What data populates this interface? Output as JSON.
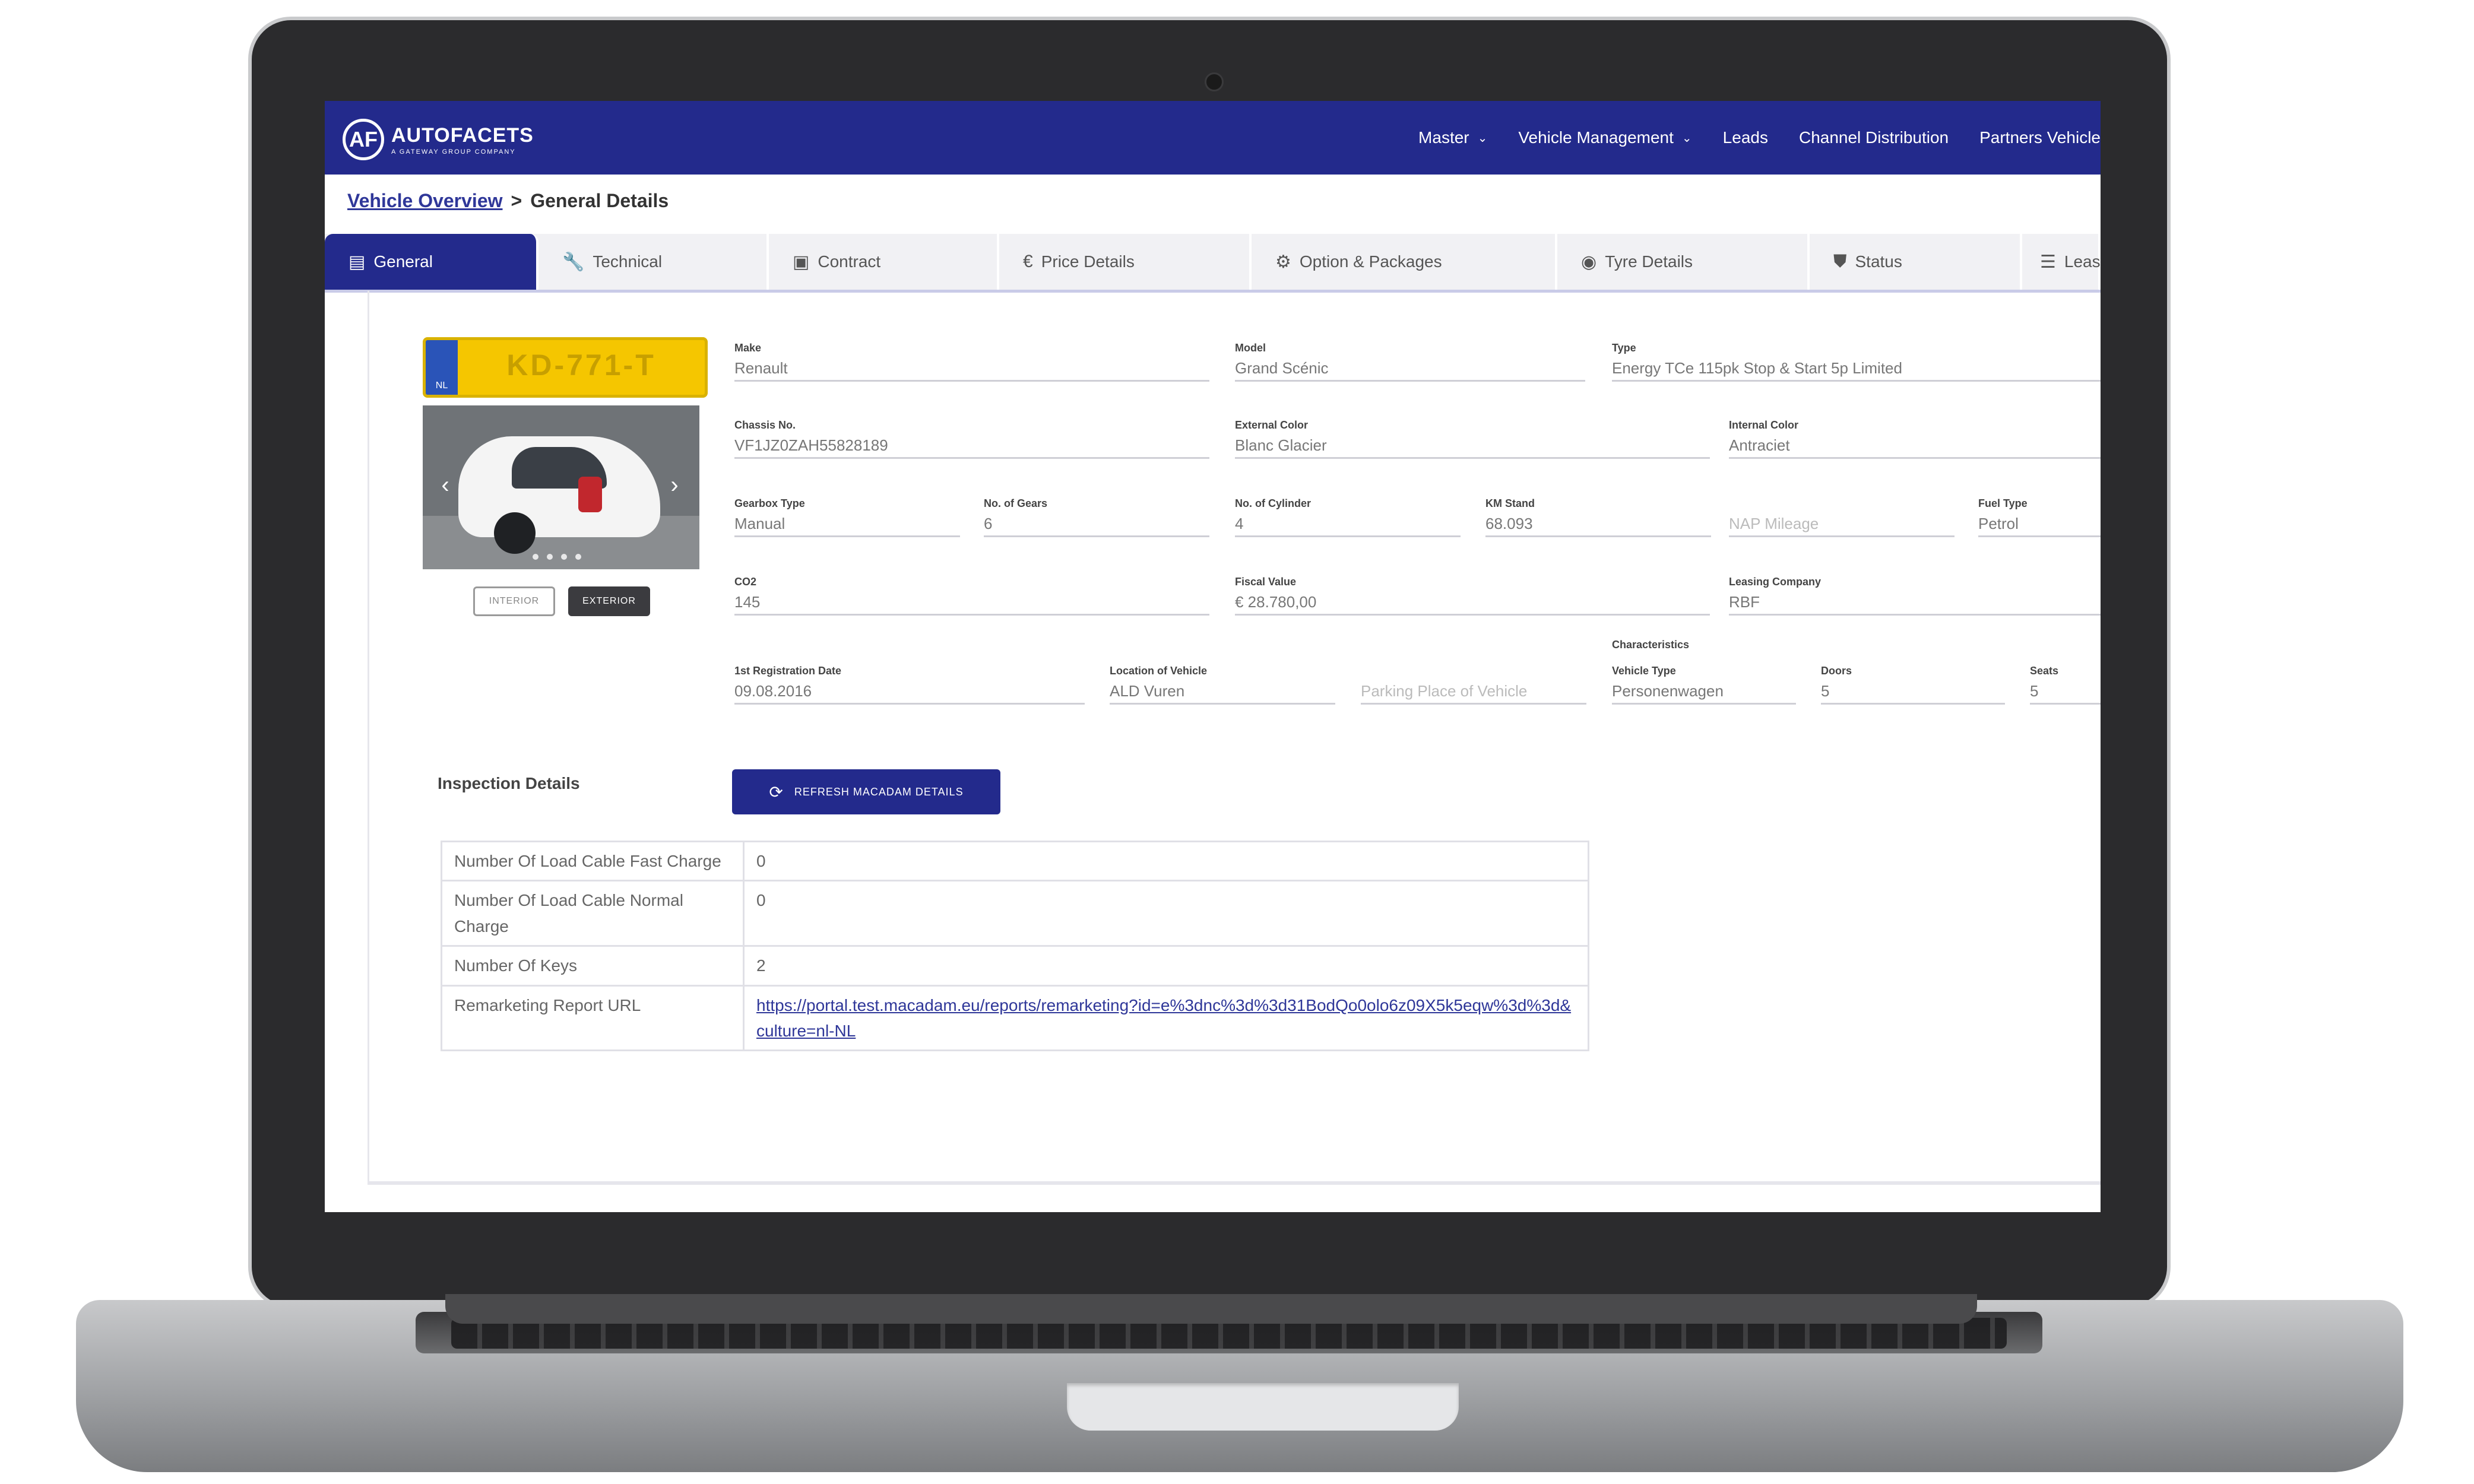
{
  "app": {
    "logo_mark": "AF",
    "logo_name": "AUTOFACETS",
    "logo_tagline": "A GATEWAY GROUP COMPANY"
  },
  "nav": {
    "items": [
      "Master",
      "Vehicle Management",
      "Leads",
      "Channel Distribution",
      "Partners Vehicle"
    ],
    "caret": "⌄"
  },
  "breadcrumb": {
    "link": "Vehicle Overview",
    "separator": ">",
    "current": "General Details"
  },
  "tabs": [
    {
      "label": "General",
      "icon": "file-icon",
      "glyph": "▤"
    },
    {
      "label": "Technical",
      "icon": "wrench-icon",
      "glyph": "🔧"
    },
    {
      "label": "Contract",
      "icon": "contract-icon",
      "glyph": "▣"
    },
    {
      "label": "Price Details",
      "icon": "euro-icon",
      "glyph": "€"
    },
    {
      "label": "Option & Packages",
      "icon": "gear-icon",
      "glyph": "⚙"
    },
    {
      "label": "Tyre Details",
      "icon": "tyre-icon",
      "glyph": "◉"
    },
    {
      "label": "Status",
      "icon": "shield-icon",
      "glyph": "⛊"
    },
    {
      "label": "Lease",
      "icon": "list-icon",
      "glyph": "☰"
    }
  ],
  "vehicle": {
    "plate": "KD-771-T",
    "plate_country": "NL",
    "photo_prev": "‹",
    "photo_next": "›",
    "view_interior": "INTERIOR",
    "view_exterior": "EXTERIOR"
  },
  "fields": {
    "make": {
      "label": "Make",
      "value": "Renault"
    },
    "model": {
      "label": "Model",
      "value": "Grand Scénic"
    },
    "type": {
      "label": "Type",
      "value": "Energy TCe 115pk Stop & Start 5p Limited"
    },
    "chassis": {
      "label": "Chassis No.",
      "value": "VF1JZ0ZAH55828189"
    },
    "external_color": {
      "label": "External Color",
      "value": "Blanc Glacier"
    },
    "internal_color": {
      "label": "Internal Color",
      "value": "Antraciet"
    },
    "gearbox": {
      "label": "Gearbox Type",
      "value": "Manual"
    },
    "gears": {
      "label": "No. of Gears",
      "value": "6"
    },
    "cylinder": {
      "label": "No. of Cylinder",
      "value": "4"
    },
    "km_stand": {
      "label": "KM Stand",
      "value": "68.093"
    },
    "nap_mileage": {
      "placeholder": "NAP Mileage"
    },
    "fuel_type": {
      "label": "Fuel Type",
      "value": "Petrol"
    },
    "co2": {
      "label": "CO2",
      "value": "145"
    },
    "fiscal_value": {
      "label": "Fiscal Value",
      "value": "€ 28.780,00"
    },
    "leasing_company": {
      "label": "Leasing Company",
      "value": "RBF"
    },
    "first_registration": {
      "label": "1st Registration Date",
      "value": "09.08.2016"
    },
    "location": {
      "label": "Location of Vehicle",
      "value": "ALD Vuren"
    },
    "parking_place": {
      "placeholder": "Parking Place of Vehicle"
    },
    "characteristics_caption": "Characteristics",
    "vehicle_type": {
      "label": "Vehicle Type",
      "value": "Personenwagen"
    },
    "doors": {
      "label": "Doors",
      "value": "5"
    },
    "seats": {
      "label": "Seats",
      "value": "5"
    }
  },
  "inspection": {
    "title": "Inspection Details",
    "refresh_icon": "refresh-icon",
    "refresh_glyph": "⟳",
    "refresh_label": "REFRESH MACADAM DETAILS",
    "rows": [
      {
        "key": "Number Of Load Cable Fast Charge",
        "value": "0"
      },
      {
        "key": "Number Of Load Cable Normal Charge",
        "value": "0"
      },
      {
        "key": "Number Of Keys",
        "value": "2"
      },
      {
        "key": "Remarketing Report URL",
        "value": "https://portal.test.macadam.eu/reports/remarketing?id=e%3dnc%3d%3d31BodQo0olo6z09X5k5eqw%3d%3d&culture=nl-NL"
      }
    ]
  },
  "colors": {
    "brand": "#232a8c",
    "plate_yellow": "#f5c600",
    "laptop_body": "#2b2b2d"
  }
}
